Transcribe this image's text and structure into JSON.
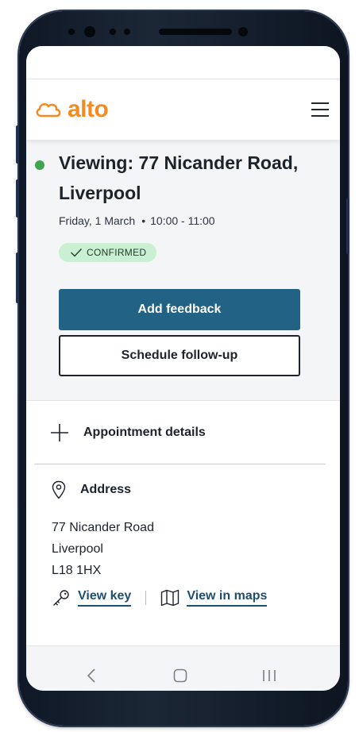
{
  "brand": {
    "name": "alto",
    "color": "#f38b1f"
  },
  "header": {
    "menu_icon": "hamburger-menu-icon"
  },
  "viewing": {
    "title": "Viewing: 77 Nicander Road, Liverpool",
    "date": "Friday, 1 March",
    "separator": "•",
    "time": "10:00 - 11:00",
    "status": "CONFIRMED",
    "status_color": "#3fa44e"
  },
  "actions": {
    "primary_label": "Add feedback",
    "secondary_label": "Schedule follow-up",
    "primary_color": "#226285"
  },
  "details": {
    "accordion_label": "Appointment details",
    "address_label": "Address",
    "address_lines": [
      "77 Nicander Road",
      "Liverpool",
      "L18 1HX"
    ],
    "view_key_label": "View key",
    "view_maps_label": "View in maps"
  },
  "system_nav": {
    "back": "back-icon",
    "home": "home-icon",
    "recents": "recents-icon"
  }
}
